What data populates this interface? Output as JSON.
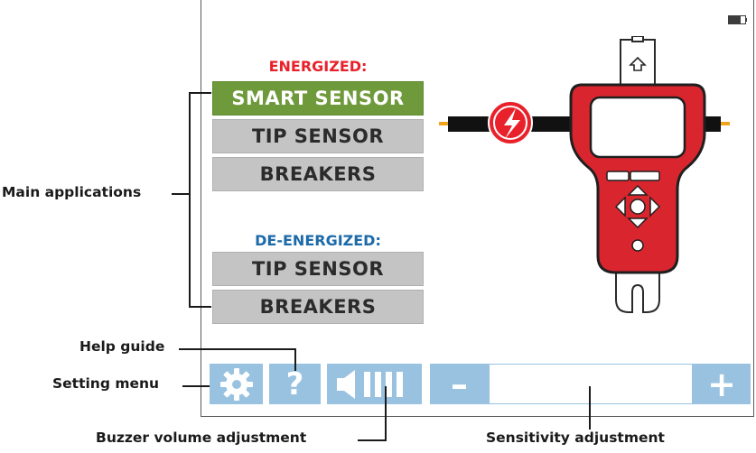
{
  "screen": {
    "battery_icon": "battery-icon",
    "energized": {
      "title": "ENERGIZED:",
      "color": "#e8212b",
      "items": [
        {
          "label": "SMART SENSOR",
          "active": true
        },
        {
          "label": "TIP SENSOR",
          "active": false
        },
        {
          "label": "BREAKERS",
          "active": false
        }
      ]
    },
    "deenergized": {
      "title": "DE-ENERGIZED:",
      "color": "#1c6aa8",
      "items": [
        {
          "label": "TIP SENSOR",
          "active": false
        },
        {
          "label": "BREAKERS",
          "active": false
        }
      ]
    },
    "device_illustration": {
      "body_color": "#d9262e",
      "screen_color": "#ffffff",
      "hazard_icon": "high-voltage-icon"
    }
  },
  "toolbar": {
    "settings_icon": "gear-icon",
    "help_label": "?",
    "volume_icon": "speaker-volume-icon",
    "minus_label": "–",
    "plus_label": "+",
    "button_color": "#99c2e0"
  },
  "annotations": {
    "main_applications": "Main applications",
    "help_guide": "Help guide",
    "setting_menu": "Setting menu",
    "buzzer_volume": "Buzzer volume adjustment",
    "sensitivity": "Sensitivity adjustment"
  },
  "colors": {
    "active_button": "#6f9a3b",
    "inactive_button": "#c4c4c4"
  }
}
